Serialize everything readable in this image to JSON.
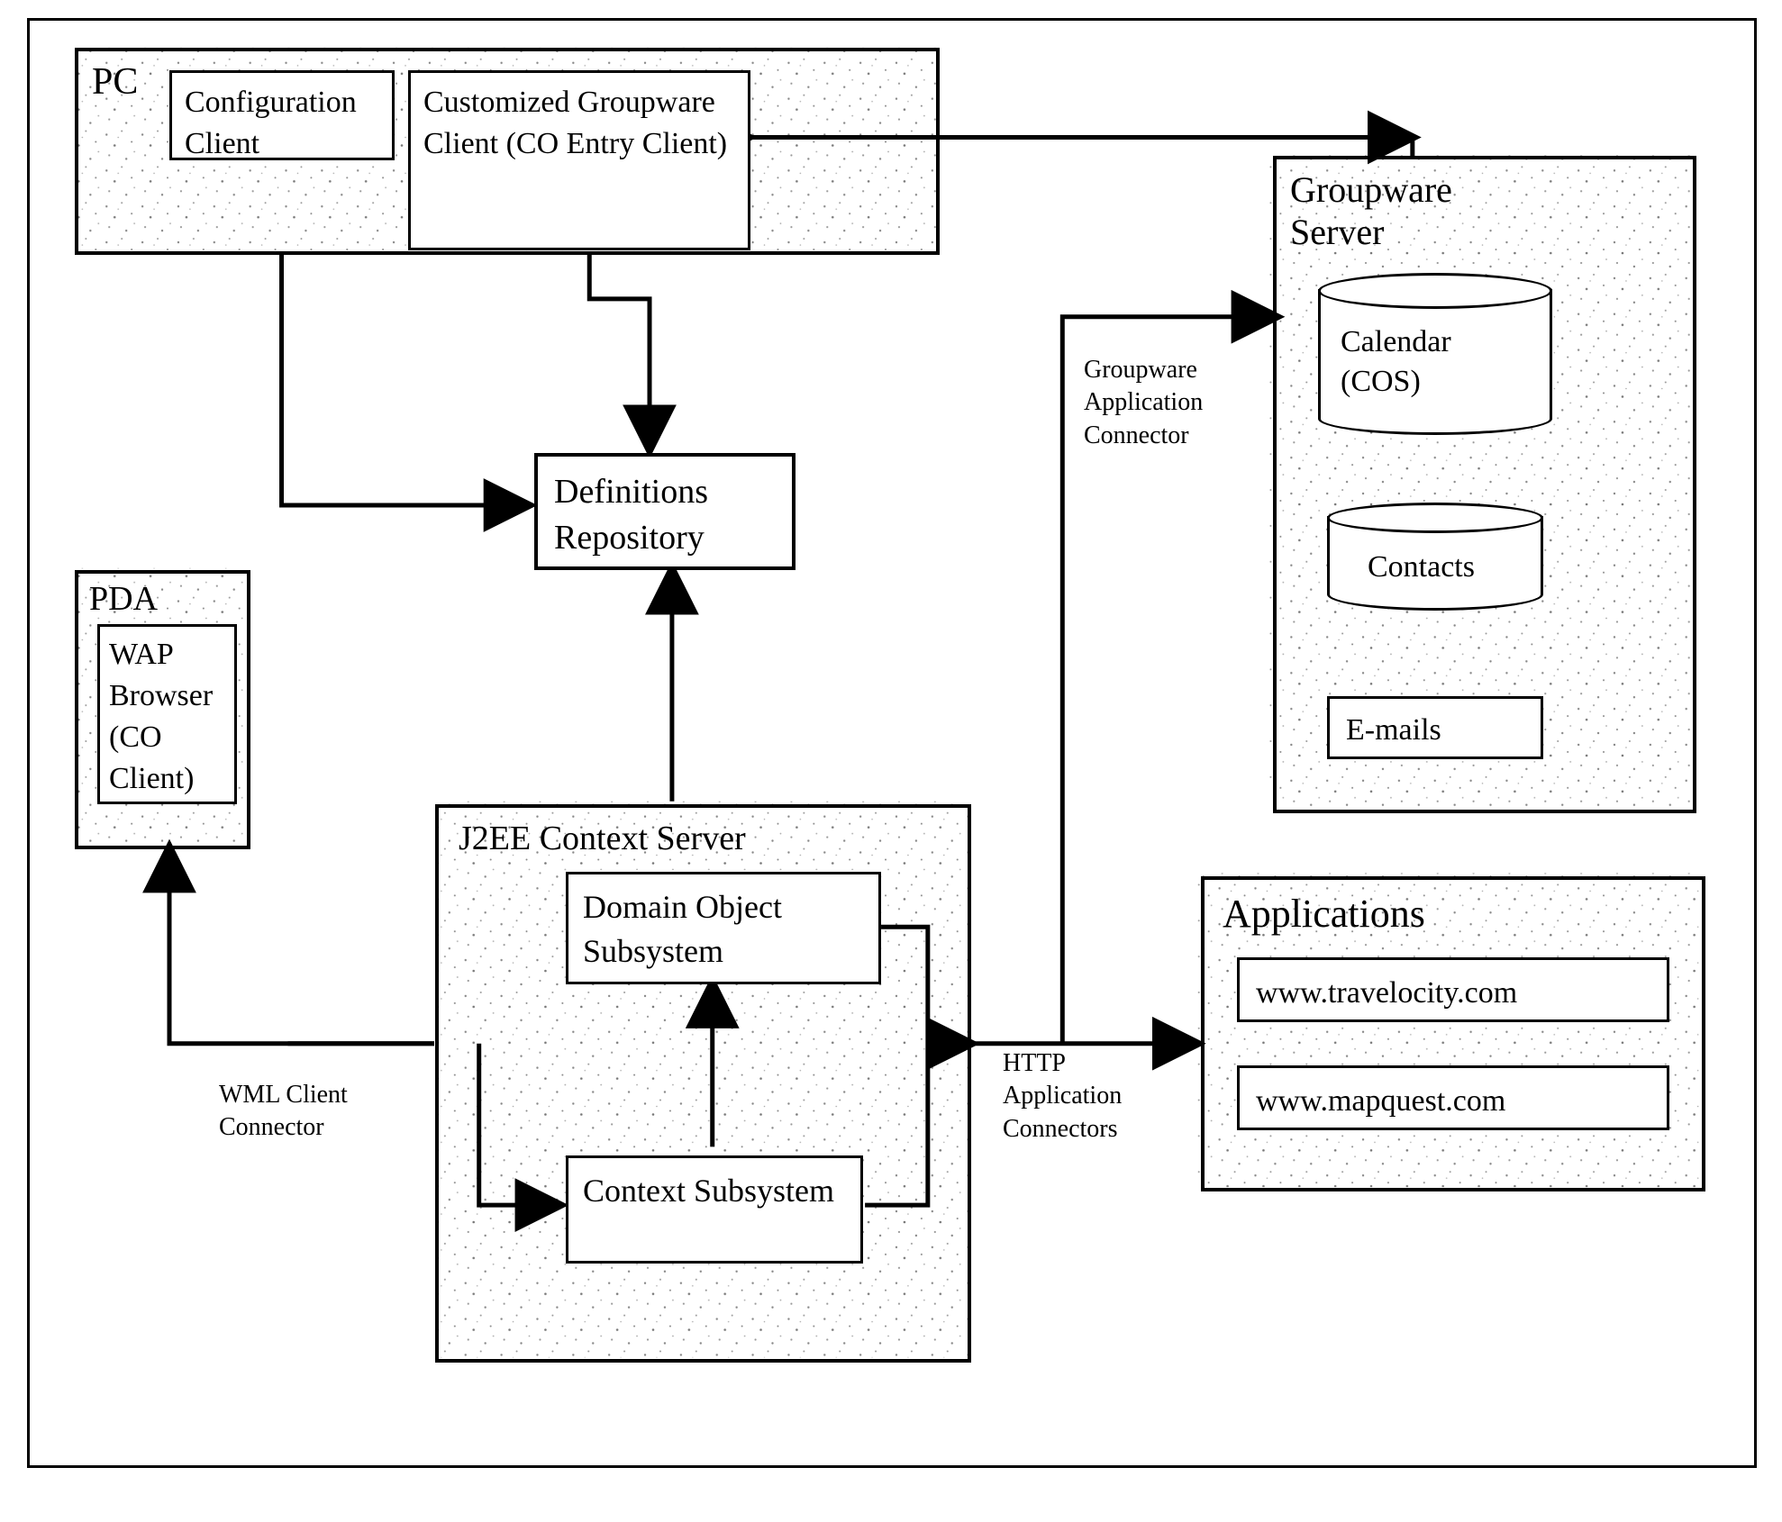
{
  "pc": {
    "title": "PC",
    "config_client": "Configuration Client",
    "groupware_client": "Customized Groupware Client (CO Entry Client)"
  },
  "pda": {
    "title": "PDA",
    "wap_browser": "WAP Browser (CO Client)"
  },
  "definitions_repo": "Definitions Repository",
  "context_server": {
    "title": "J2EE Context Server",
    "domain_obj": "Domain Object Subsystem",
    "context_sub": "Context Subsystem"
  },
  "groupware_server": {
    "title": "Groupware Server",
    "calendar": "Calendar (COS)",
    "contacts": "Contacts",
    "emails": "E-mails"
  },
  "applications": {
    "title": "Applications",
    "app1": "www.travelocity.com",
    "app2": "www.mapquest.com"
  },
  "labels": {
    "wml": "WML Client Connector",
    "http": "HTTP Application Connectors",
    "groupware_conn": "Groupware Application Connector"
  }
}
